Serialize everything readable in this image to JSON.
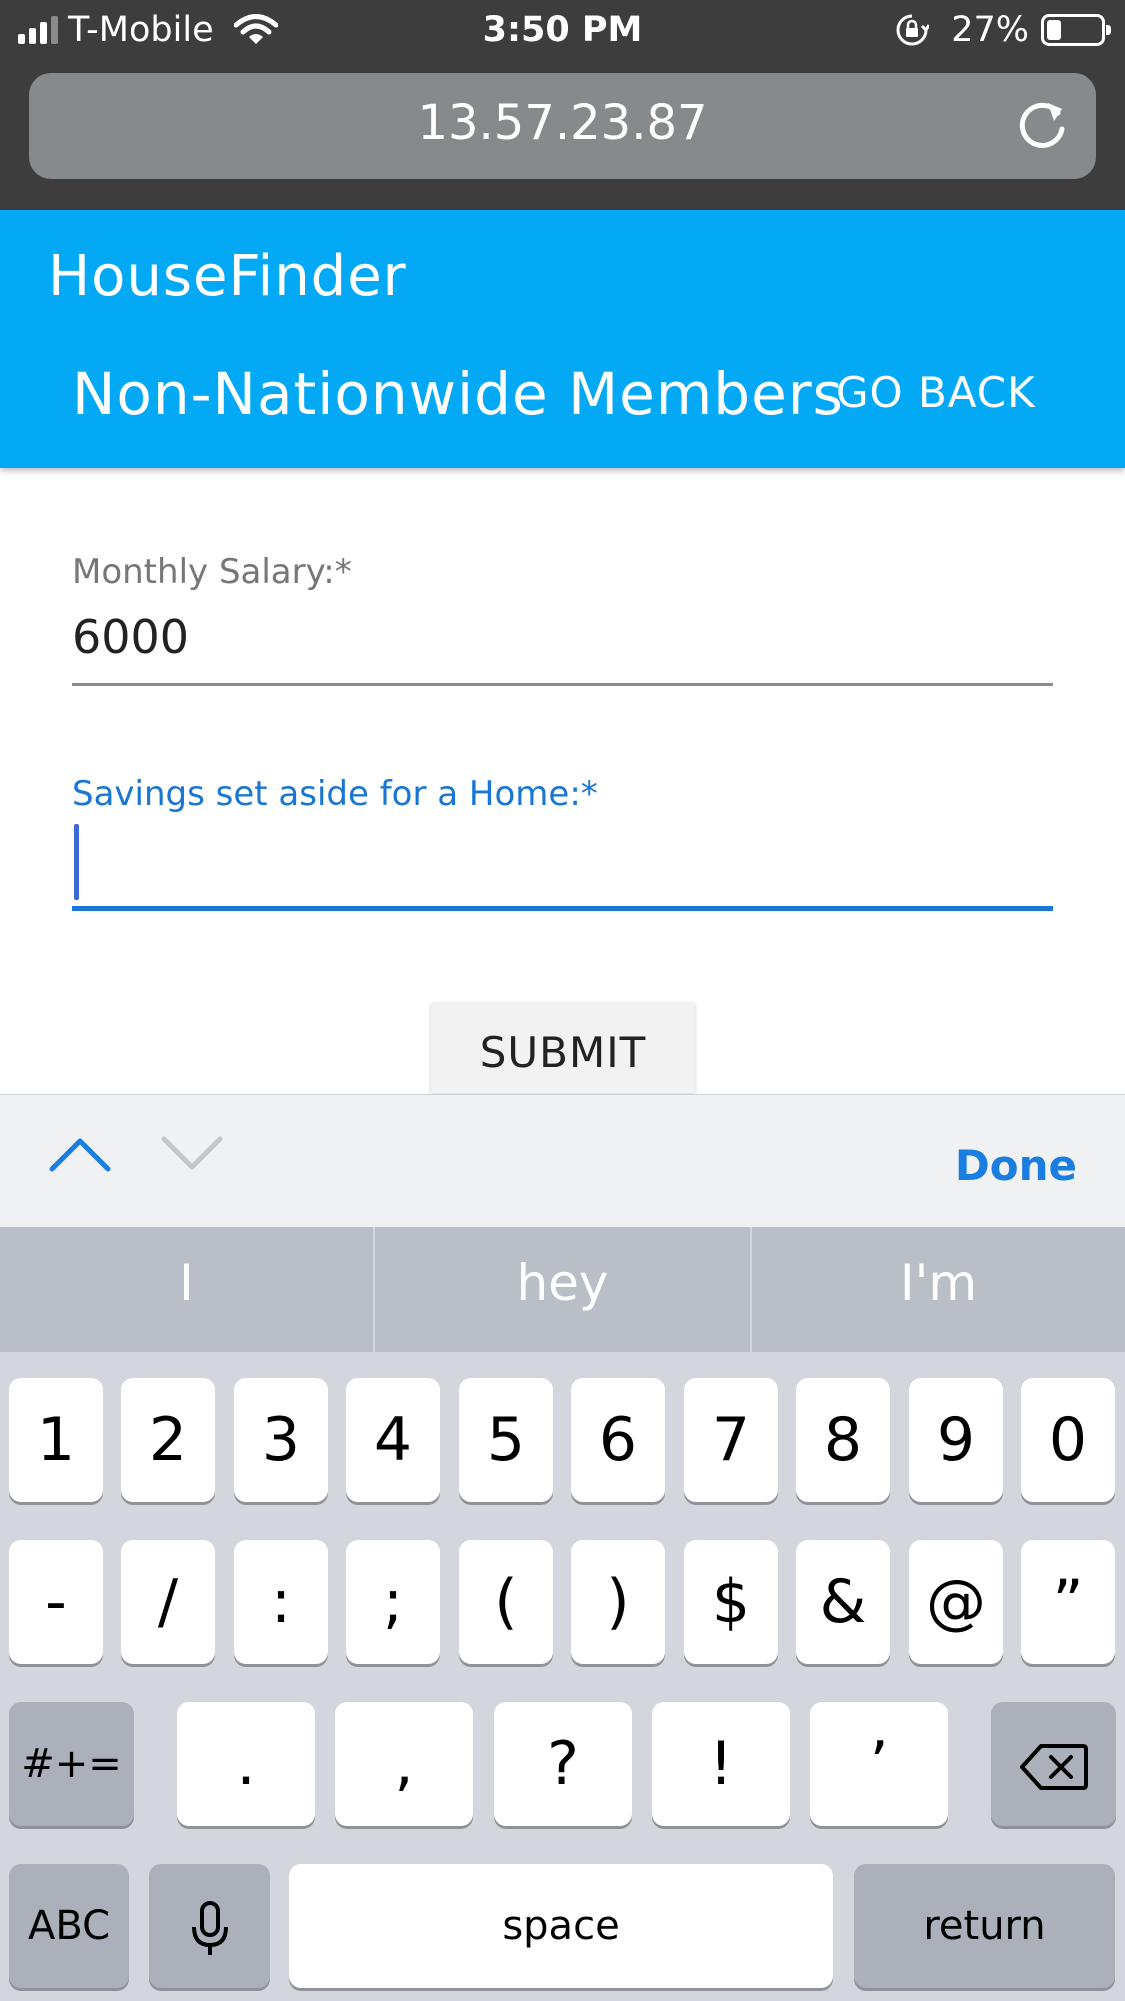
{
  "status_bar": {
    "carrier": "T-Mobile",
    "time": "3:50 PM",
    "battery_percent": "27%",
    "battery_level": 0.27
  },
  "browser": {
    "url": "13.57.23.87"
  },
  "app_bar": {
    "app_name": "HouseFinder",
    "page_title": "Non-Nationwide Members",
    "back_label": "GO BACK"
  },
  "form": {
    "salary": {
      "label": "Monthly Salary:*",
      "value": "6000"
    },
    "savings": {
      "label": "Savings set aside for a Home:*",
      "value": ""
    },
    "submit_label": "SUBMIT"
  },
  "accessory": {
    "done_label": "Done"
  },
  "keyboard": {
    "suggestions": [
      "I",
      "hey",
      "I'm"
    ],
    "row1": [
      "1",
      "2",
      "3",
      "4",
      "5",
      "6",
      "7",
      "8",
      "9",
      "0"
    ],
    "row2": [
      "-",
      "/",
      ":",
      ";",
      "(",
      ")",
      "$",
      "&",
      "@",
      "”"
    ],
    "row3": {
      "mode": "#+=",
      "keys": [
        ".",
        ",",
        "?",
        "!",
        "’"
      ]
    },
    "row4": {
      "abc": "ABC",
      "space": "space",
      "return": "return"
    }
  },
  "colors": {
    "app_bar": "#03a9f4",
    "focus": "#1976d2",
    "done": "#1a7de0"
  }
}
